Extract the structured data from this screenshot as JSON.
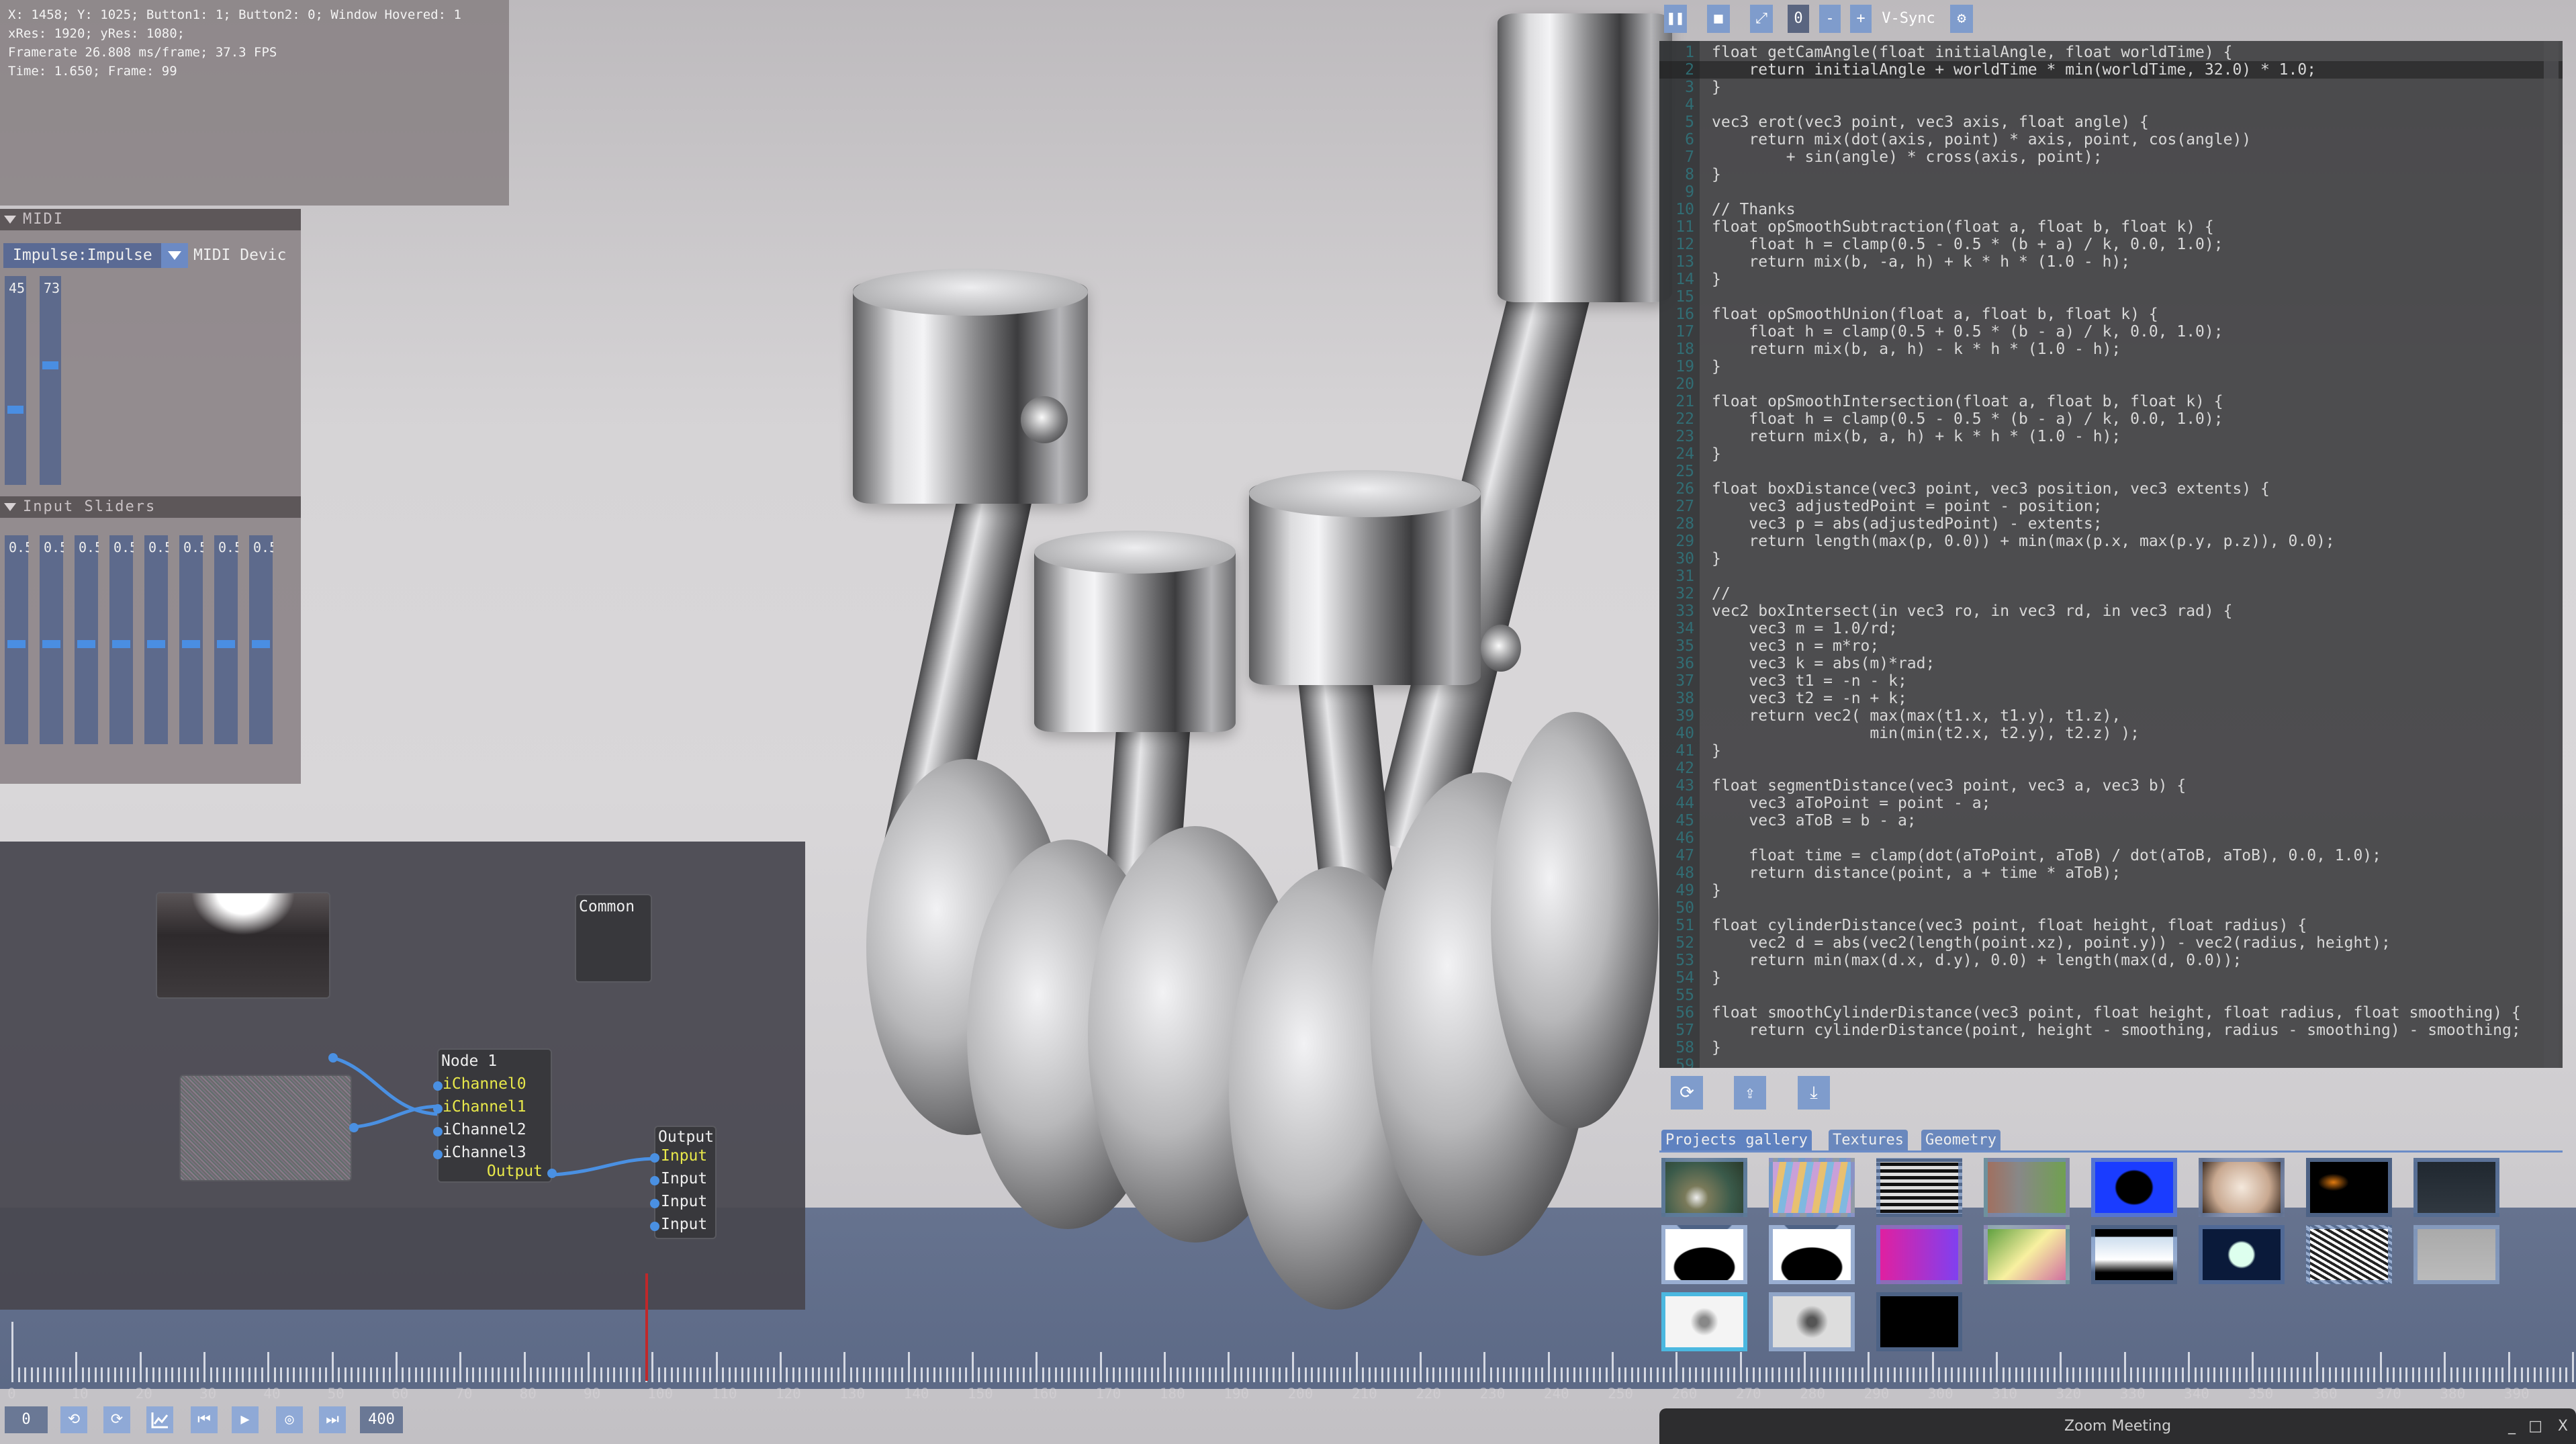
{
  "info": {
    "lines": [
      "X: 1458; Y: 1025; Button1: 1; Button2: 0; Window Hovered: 1",
      "xRes: 1920; yRes: 1080;",
      "Framerate 26.808 ms/frame; 37.3 FPS",
      "Time: 1.650; Frame: 99"
    ]
  },
  "midi": {
    "title": "MIDI",
    "device": "Impulse:Impulse M",
    "device_label": "MIDI Devic",
    "sliders": [
      45,
      73
    ],
    "slider_max": 127
  },
  "input_sliders": {
    "title": "Input Sliders",
    "values": [
      "0.5",
      "0.5",
      "0.5",
      "0.5",
      "0.5",
      "0.5",
      "0.5",
      "0.5"
    ],
    "level": 0.5
  },
  "nodes": {
    "common": "Common",
    "node1": {
      "title": "Node 1",
      "inputs": [
        "iChannel0",
        "iChannel1",
        "iChannel2",
        "iChannel3"
      ],
      "connected": [
        true,
        true,
        false,
        false
      ],
      "output": "Output"
    },
    "output": {
      "title": "Output",
      "inputs": [
        "Input",
        "Input",
        "Input",
        "Input"
      ],
      "connected": [
        true,
        false,
        false,
        false
      ]
    }
  },
  "toolbar": {
    "pause_icon": "pause-icon",
    "stop_icon": "stop-icon",
    "fullscreen_icon": "expand-icon",
    "counter": "0",
    "minus": "-",
    "plus": "+",
    "vsync": "V-Sync",
    "settings_icon": "gear-icon"
  },
  "editor": {
    "current_line": 2,
    "lines": [
      "float getCamAngle(float initialAngle, float worldTime) {",
      "    return initialAngle + worldTime * min(worldTime, 32.0) * 1.0;",
      "}",
      "",
      "vec3 erot(vec3 point, vec3 axis, float angle) {",
      "    return mix(dot(axis, point) * axis, point, cos(angle))",
      "        + sin(angle) * cross(axis, point);",
      "}",
      "",
      "// Thanks",
      "float opSmoothSubtraction(float a, float b, float k) {",
      "    float h = clamp(0.5 - 0.5 * (b + a) / k, 0.0, 1.0);",
      "    return mix(b, -a, h) + k * h * (1.0 - h);",
      "}",
      "",
      "float opSmoothUnion(float a, float b, float k) {",
      "    float h = clamp(0.5 + 0.5 * (b - a) / k, 0.0, 1.0);",
      "    return mix(b, a, h) - k * h * (1.0 - h);",
      "}",
      "",
      "float opSmoothIntersection(float a, float b, float k) {",
      "    float h = clamp(0.5 - 0.5 * (b - a) / k, 0.0, 1.0);",
      "    return mix(b, a, h) + k * h * (1.0 - h);",
      "}",
      "",
      "float boxDistance(vec3 point, vec3 position, vec3 extents) {",
      "    vec3 adjustedPoint = point - position;",
      "    vec3 p = abs(adjustedPoint) - extents;",
      "    return length(max(p, 0.0)) + min(max(p.x, max(p.y, p.z)), 0.0);",
      "}",
      "",
      "//",
      "vec2 boxIntersect(in vec3 ro, in vec3 rd, in vec3 rad) {",
      "    vec3 m = 1.0/rd;",
      "    vec3 n = m*ro;",
      "    vec3 k = abs(m)*rad;",
      "    vec3 t1 = -n - k;",
      "    vec3 t2 = -n + k;",
      "    return vec2( max(max(t1.x, t1.y), t1.z),",
      "                 min(min(t2.x, t2.y), t2.z) );",
      "}",
      "",
      "float segmentDistance(vec3 point, vec3 a, vec3 b) {",
      "    vec3 aToPoint = point - a;",
      "    vec3 aToB = b - a;",
      "",
      "    float time = clamp(dot(aToPoint, aToB) / dot(aToB, aToB), 0.0, 1.0);",
      "    return distance(point, a + time * aToB);",
      "}",
      "",
      "float cylinderDistance(vec3 point, float height, float radius) {",
      "    vec2 d = abs(vec2(length(point.xz), point.y)) - vec2(radius, height);",
      "    return min(max(d.x, d.y), 0.0) + length(max(d, 0.0));",
      "}",
      "",
      "float smoothCylinderDistance(vec3 point, float height, float radius, float smoothing) {",
      "    return cylinderDistance(point, height - smoothing, radius - smoothing) - smoothing;",
      "}",
      ""
    ],
    "buttons": [
      "refresh-icon",
      "upload-icon",
      "download-icon"
    ]
  },
  "gallery": {
    "tabs": [
      "Projects gallery",
      "Textures",
      "Geometry"
    ],
    "active_tab": 0,
    "thumbnail_count": 19,
    "selected_index": 16
  },
  "timeline": {
    "start": 0,
    "end": 400,
    "label_step": 10,
    "cursor_frame": 99,
    "start_field": "0",
    "end_field": "400",
    "buttons": [
      "rewind-icon",
      "loop-icon",
      "graph-icon",
      "skip-back-icon",
      "play-icon",
      "record-icon",
      "skip-forward-icon"
    ]
  },
  "zoom_window": {
    "title": "Zoom Meeting",
    "minimize": "_",
    "maximize": "□",
    "close": "X"
  },
  "colors": {
    "accent": "#4a90e2",
    "button": "#7f9ccc",
    "keyword": "#7aa6dc",
    "number": "#38c838",
    "node_label_active": "#e8e84a",
    "timeline_cursor": "#c0282a"
  }
}
